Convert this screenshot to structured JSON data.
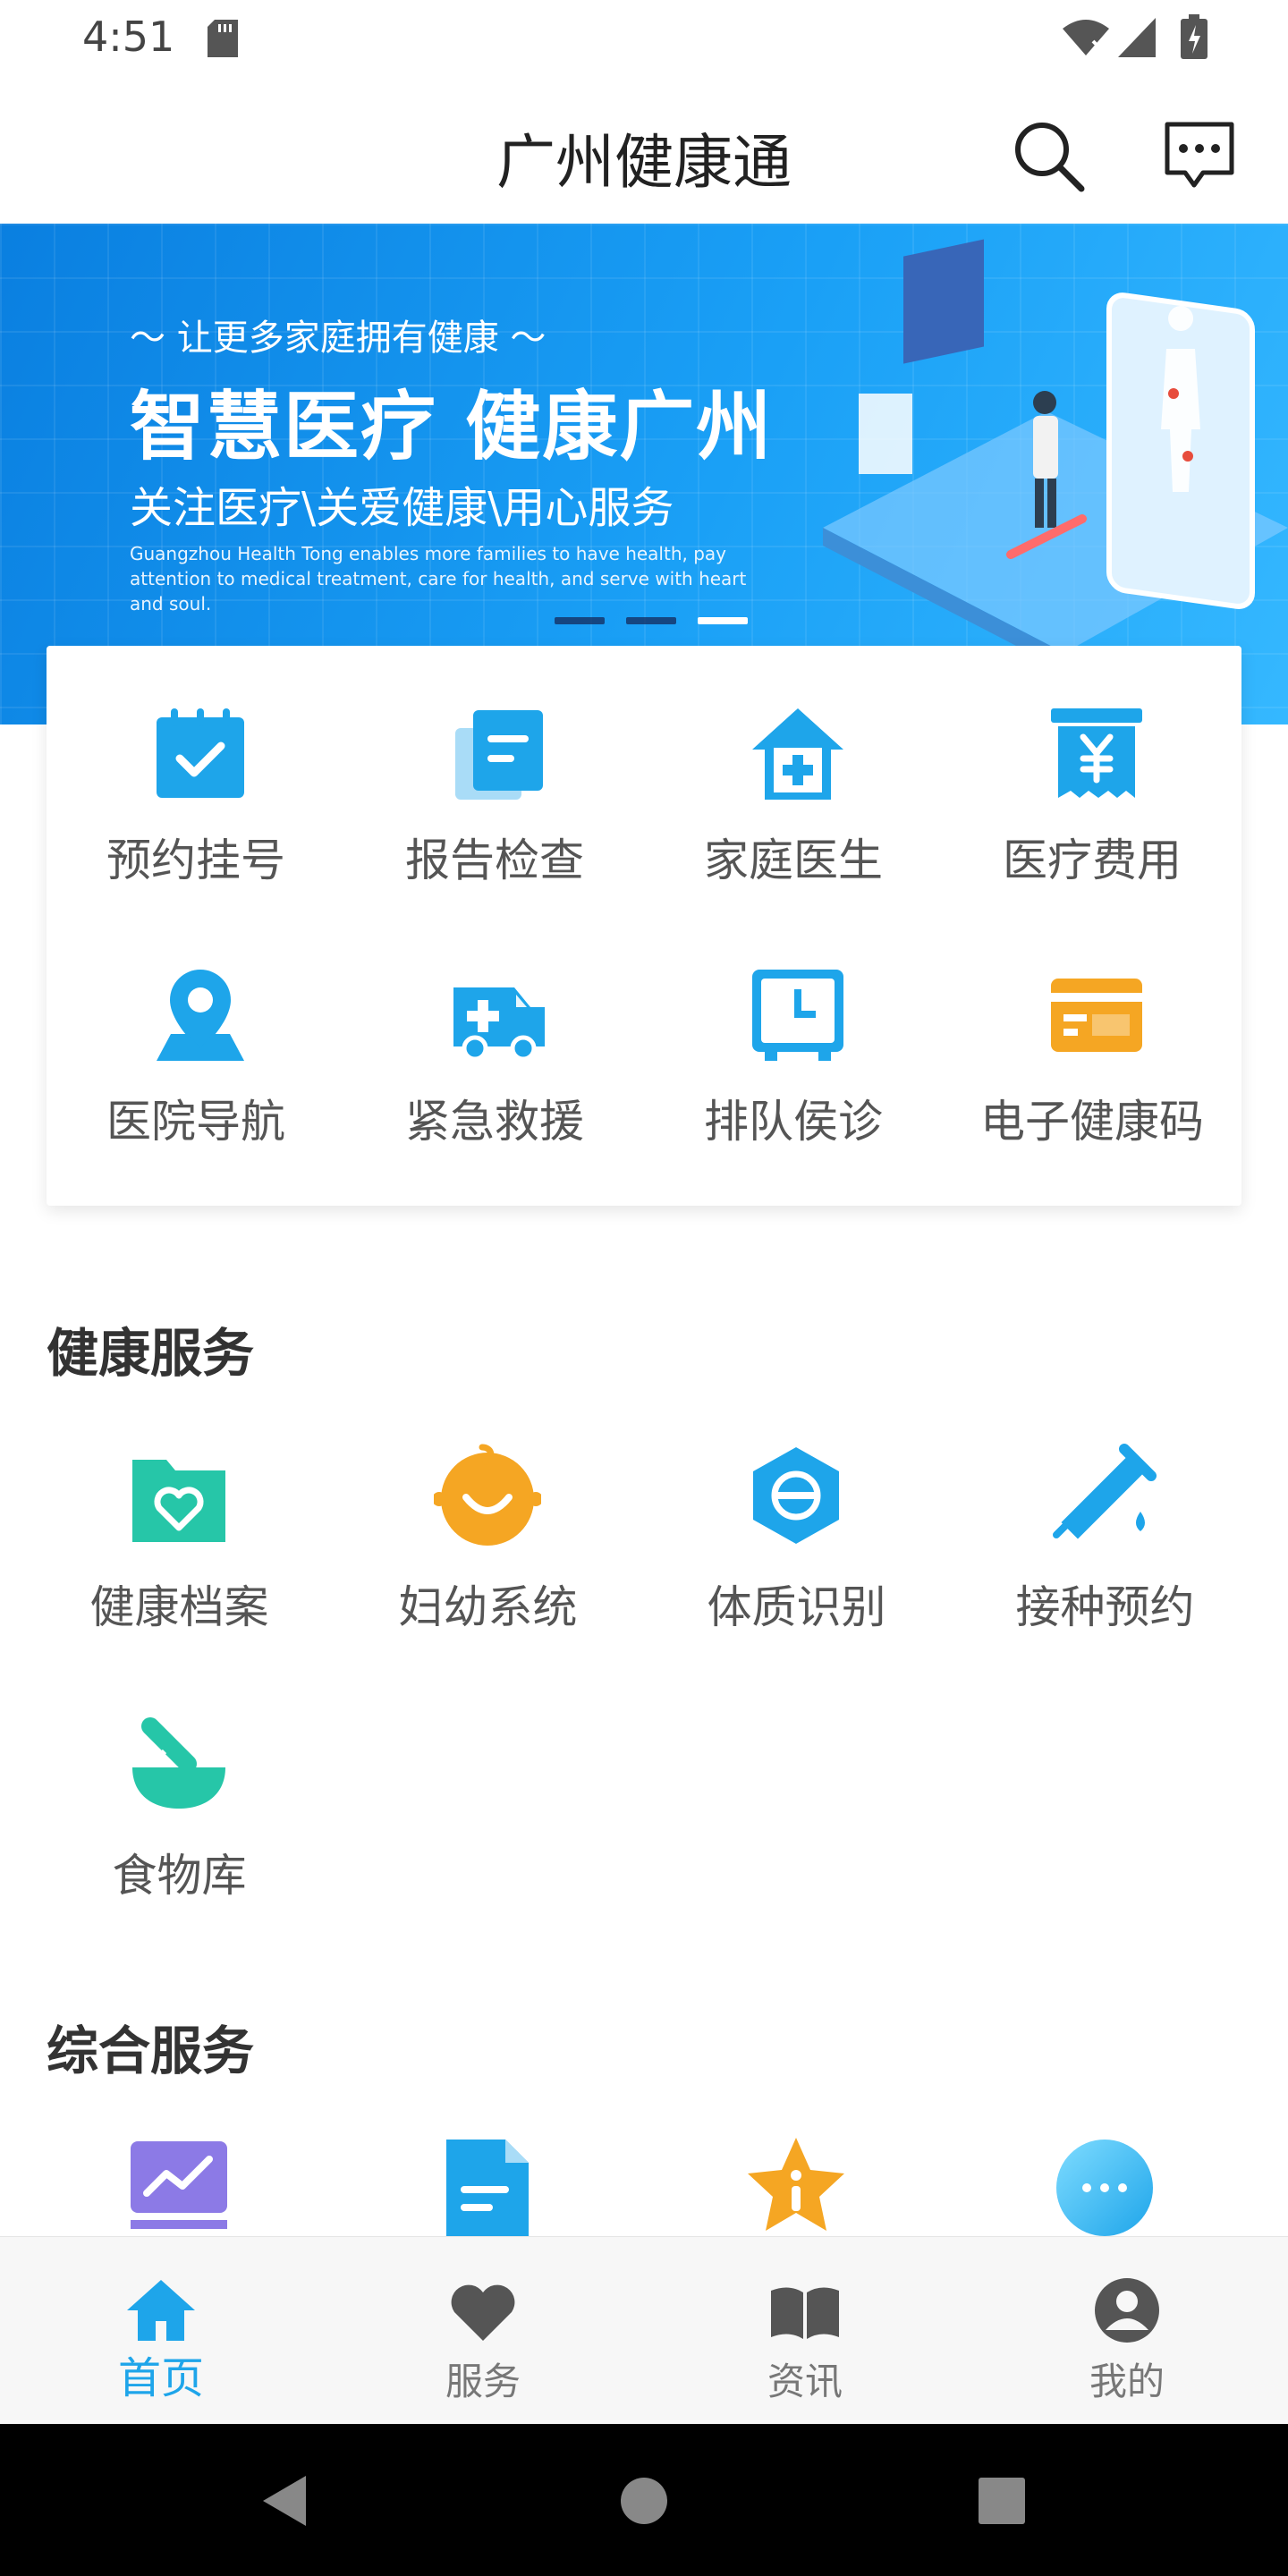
{
  "status_bar": {
    "time": "4:51"
  },
  "app_bar": {
    "title": "广州健康通"
  },
  "banner": {
    "subtitle": "让更多家庭拥有健康",
    "title": "智慧医疗  健康广州",
    "slogan": "关注医疗\\关爱健康\\用心服务",
    "english": "Guangzhou Health Tong enables more families to have health, pay attention to medical treatment, care for health, and serve with heart and soul.",
    "active_slide": 3,
    "slide_count": 3
  },
  "quick_actions": [
    {
      "label": "预约挂号",
      "icon": "calendar-check-icon"
    },
    {
      "label": "报告检查",
      "icon": "report-icon"
    },
    {
      "label": "家庭医生",
      "icon": "home-plus-icon"
    },
    {
      "label": "医疗费用",
      "icon": "yuan-receipt-icon"
    },
    {
      "label": "医院导航",
      "icon": "location-pin-icon"
    },
    {
      "label": "紧急救援",
      "icon": "ambulance-icon"
    },
    {
      "label": "排队侯诊",
      "icon": "clock-screen-icon"
    },
    {
      "label": "电子健康码",
      "icon": "card-icon"
    }
  ],
  "health_services": {
    "title": "健康服务",
    "items": [
      {
        "label": "健康档案",
        "icon": "heart-folder-icon"
      },
      {
        "label": "妇幼系统",
        "icon": "baby-face-icon"
      },
      {
        "label": "体质识别",
        "icon": "hexagon-icon"
      },
      {
        "label": "接种预约",
        "icon": "syringe-icon"
      },
      {
        "label": "食物库",
        "icon": "food-bowl-icon"
      }
    ]
  },
  "general_services": {
    "title": "综合服务",
    "items": [
      {
        "icon": "chart-monitor-icon"
      },
      {
        "icon": "document-icon"
      },
      {
        "icon": "star-info-icon"
      },
      {
        "icon": "more-dots-icon"
      }
    ]
  },
  "bottom_nav": [
    {
      "label": "首页",
      "icon": "home-icon",
      "active": true
    },
    {
      "label": "服务",
      "icon": "heart-icon",
      "active": false
    },
    {
      "label": "资讯",
      "icon": "book-icon",
      "active": false
    },
    {
      "label": "我的",
      "icon": "user-icon",
      "active": false
    }
  ],
  "colors": {
    "primary": "#1ea5ea",
    "orange": "#f5a623",
    "teal": "#26c6a8",
    "purple": "#8c7ae6"
  }
}
